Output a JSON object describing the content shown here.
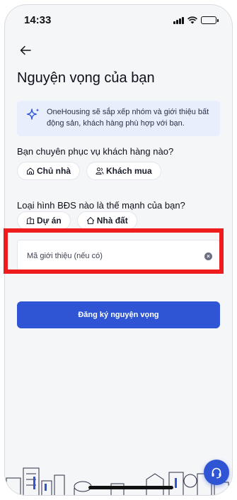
{
  "status_bar": {
    "time": "14:33"
  },
  "header": {
    "title": "Nguyện vọng của bạn"
  },
  "info_banner": {
    "text": "OneHousing sẽ sắp xếp nhóm và giới thiệu bất động sản, khách hàng phù hợp với bạn.",
    "icon": "sparkle-icon"
  },
  "question1": {
    "label": "Bạn chuyên phục vụ khách hàng nào?",
    "options": [
      {
        "label": "Chủ nhà",
        "icon": "house-icon"
      },
      {
        "label": "Khách mua",
        "icon": "people-icon"
      }
    ]
  },
  "question2": {
    "label": "Loại hình BĐS nào là thế mạnh của bạn?",
    "options": [
      {
        "label": "Dự án",
        "icon": "building-icon"
      },
      {
        "label": "Nhà đất",
        "icon": "home-icon"
      }
    ]
  },
  "referral": {
    "placeholder": "Mã giới thiệu (nếu có)",
    "value": ""
  },
  "submit": {
    "label": "Đăng ký nguyện vọng"
  },
  "colors": {
    "primary": "#2f55d4",
    "banner_bg": "#e8eefc",
    "highlight": "#ee1c1c",
    "page_bg": "#f5f6f8"
  }
}
